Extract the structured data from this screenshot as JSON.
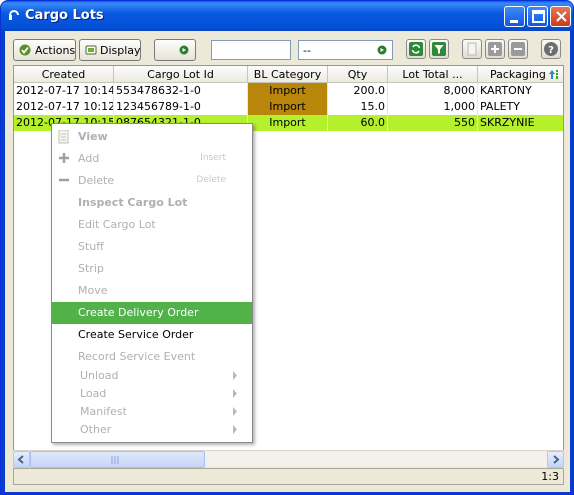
{
  "window": {
    "title": "Cargo Lots"
  },
  "toolbar": {
    "actions_label": "Actions",
    "display_label": "Display",
    "filter_value": "",
    "combo_value": "--"
  },
  "grid": {
    "columns": [
      "Created",
      "Cargo Lot Id",
      "BL Category",
      "Qty",
      "Lot Total ...",
      "Packaging"
    ],
    "rows": [
      {
        "created": "2012-07-17 10:14",
        "lot_id": "553478632-1-0",
        "category": "Import",
        "qty": "200.0",
        "total": "8,000",
        "packaging": "KARTONY"
      },
      {
        "created": "2012-07-17 10:12",
        "lot_id": "123456789-1-0",
        "category": "Import",
        "qty": "15.0",
        "total": "1,000",
        "packaging": "PALETY"
      },
      {
        "created": "2012-07-17 10:15",
        "lot_id": "087654321-1-0",
        "category": "Import",
        "qty": "60.0",
        "total": "550",
        "packaging": "SKRZYNIE"
      }
    ]
  },
  "colors": {
    "category_bg": "#b8860b",
    "selected_row": "#b4f02c",
    "menu_highlight": "#52b24a"
  },
  "status": {
    "position": "1:3"
  },
  "menu": {
    "view": "View",
    "add": "Add",
    "add_shortcut": "Insert",
    "delete": "Delete",
    "delete_shortcut": "Delete",
    "inspect": "Inspect Cargo Lot",
    "edit": "Edit Cargo Lot",
    "stuff": "Stuff",
    "strip": "Strip",
    "move": "Move",
    "create_delivery": "Create Delivery Order",
    "create_service": "Create Service Order",
    "record_event": "Record Service Event",
    "unload": "Unload",
    "load": "Load",
    "manifest": "Manifest",
    "other": "Other"
  }
}
